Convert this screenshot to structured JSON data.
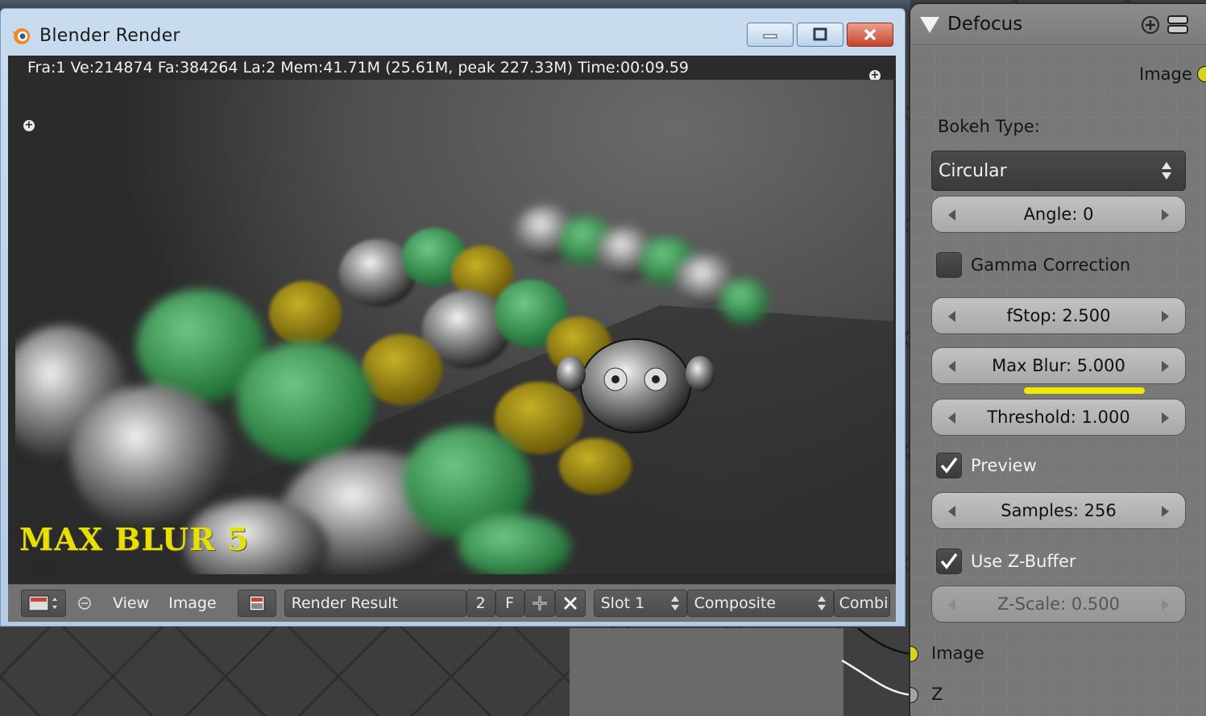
{
  "window": {
    "title": "Blender Render",
    "stats": "Fra:1  Ve:214874 Fa:384264 La:2 Mem:41.71M (25.61M, peak 227.33M) Time:00:09.59",
    "overlay_text": "MAX BLUR 5"
  },
  "toolbar": {
    "view_label": "View",
    "image_label": "Image",
    "image_name": "Render Result",
    "users_count": "2",
    "fake_user": "F",
    "slot": "Slot 1",
    "layer": "Composite",
    "pass": "Combi"
  },
  "node": {
    "title": "Defocus",
    "output_image": "Image",
    "bokeh_type_label": "Bokeh Type:",
    "bokeh_type_value": "Circular",
    "angle": "Angle: 0",
    "gamma_correction": "Gamma Correction",
    "gamma_checked": false,
    "fstop": "fStop: 2.500",
    "max_blur": "Max Blur: 5.000",
    "threshold": "Threshold: 1.000",
    "preview": "Preview",
    "preview_checked": true,
    "samples": "Samples: 256",
    "use_zbuffer": "Use Z-Buffer",
    "zbuffer_checked": true,
    "zscale": "Z-Scale: 0.500",
    "input_image": "Image",
    "input_z": "Z"
  },
  "colors": {
    "highlight": "#f0ea00",
    "socket_image": "#d8d21f",
    "socket_z": "#a3a3a3",
    "close_button": "#c5442c"
  }
}
